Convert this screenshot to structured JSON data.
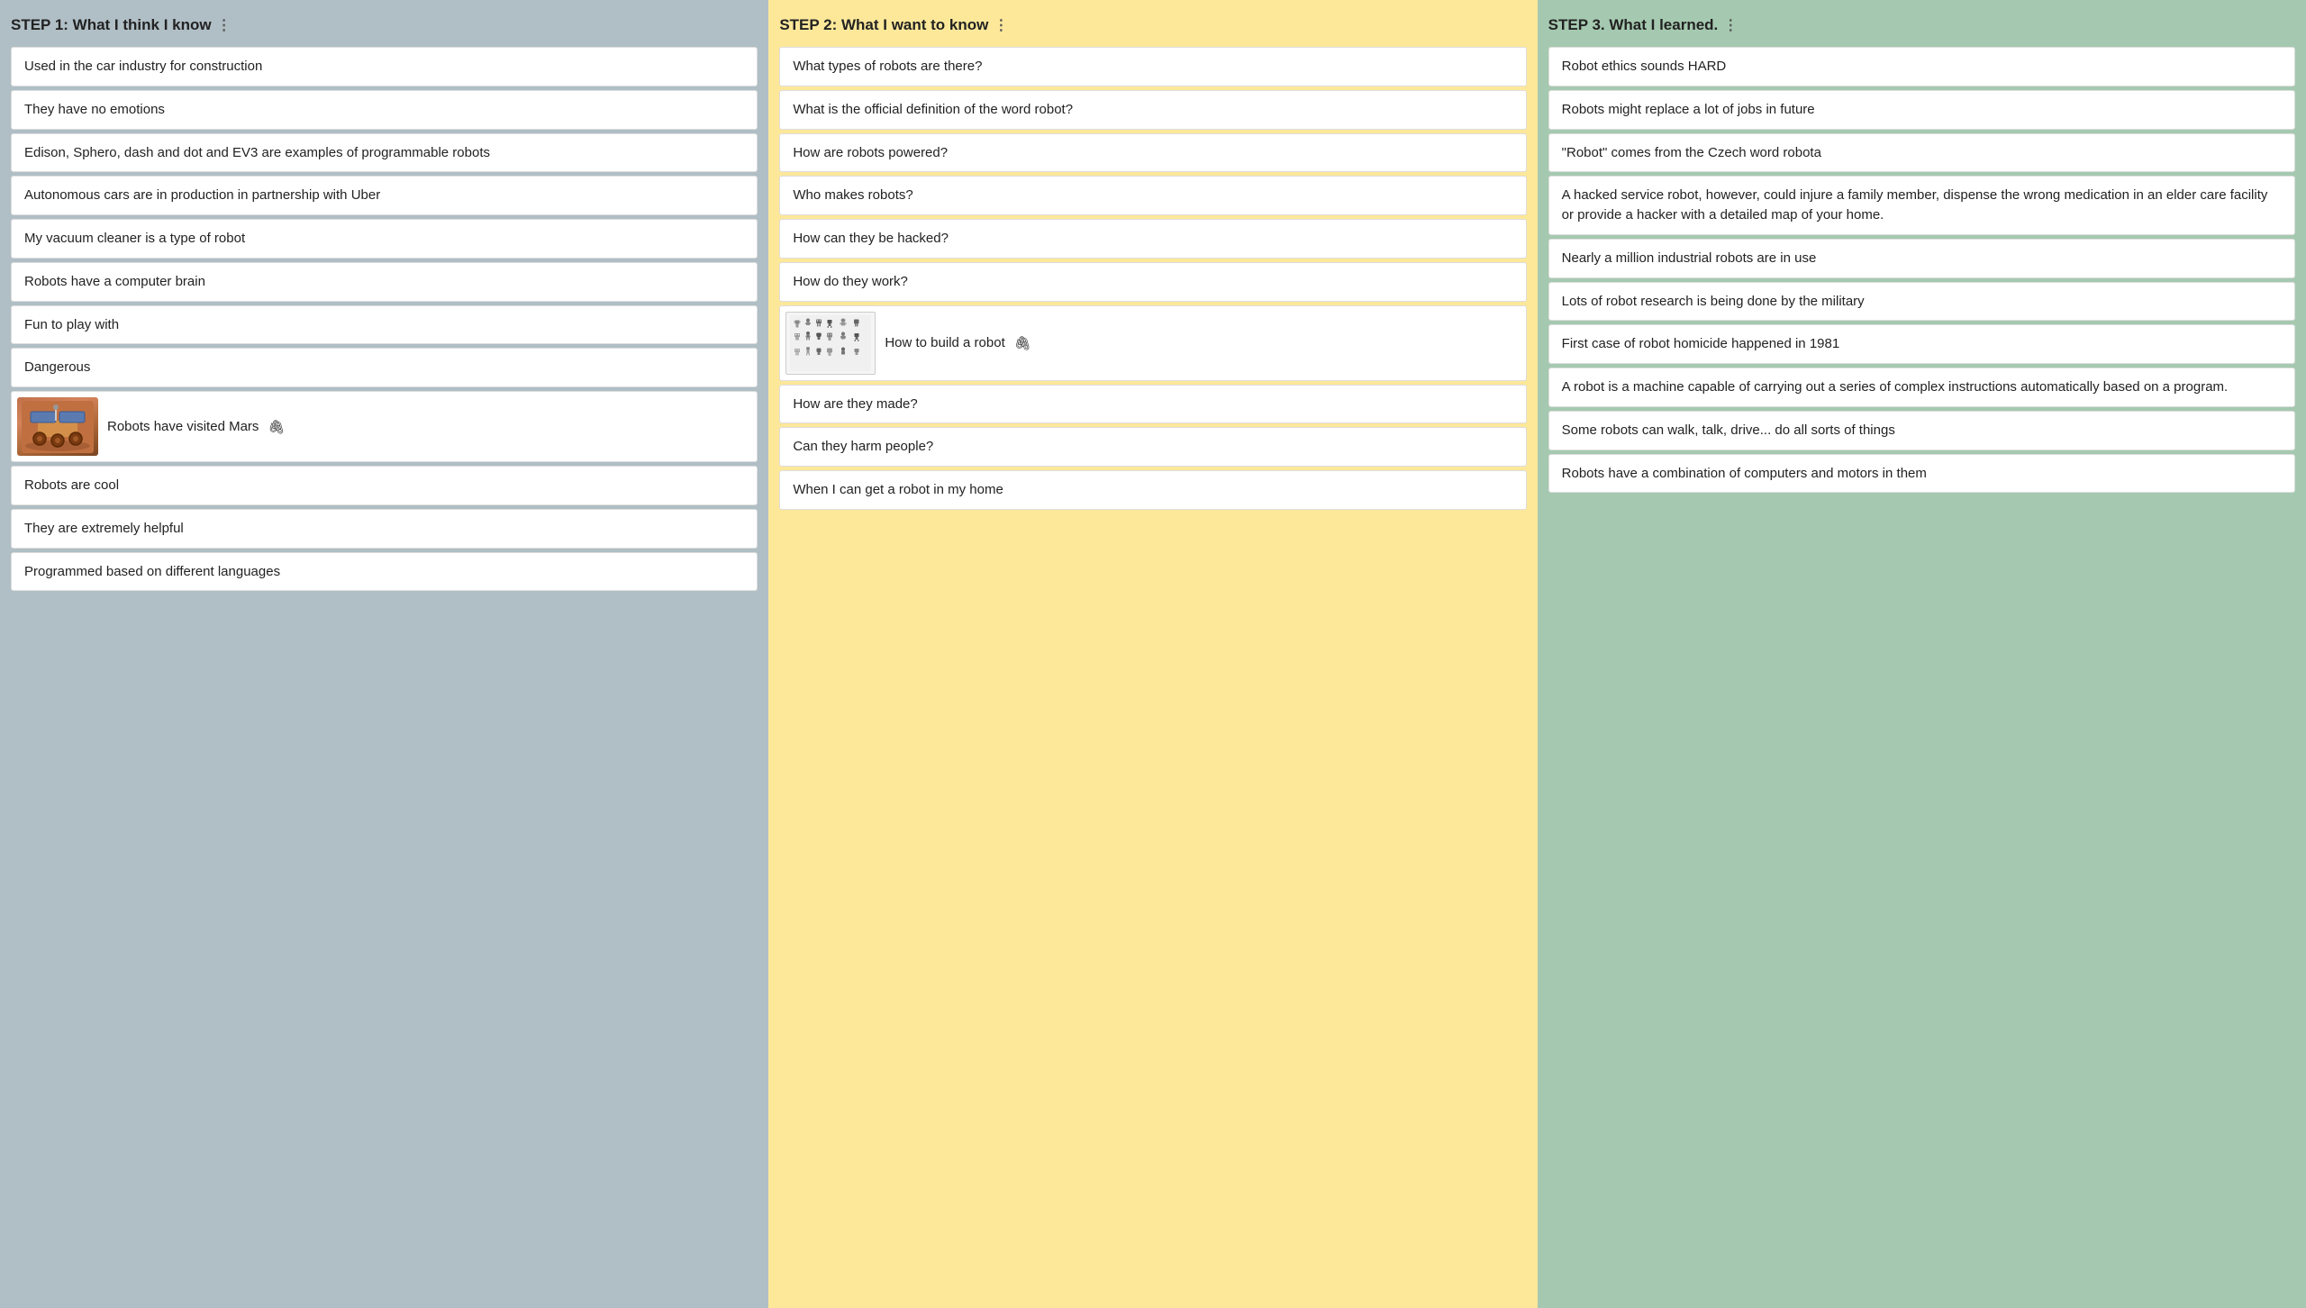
{
  "columns": [
    {
      "id": "know",
      "header": "STEP 1: What I think I know",
      "bg": "#b0bec5",
      "items": [
        {
          "type": "text",
          "text": "Used in the car industry for construction"
        },
        {
          "type": "text",
          "text": "They have no emotions"
        },
        {
          "type": "text",
          "text": "Edison, Sphero, dash and dot and EV3 are examples of programmable robots"
        },
        {
          "type": "text",
          "text": "Autonomous cars are in production in partnership with Uber"
        },
        {
          "type": "text",
          "text": "My vacuum cleaner is a type of robot"
        },
        {
          "type": "text",
          "text": "Robots have a computer brain"
        },
        {
          "type": "text",
          "text": "Fun to play with"
        },
        {
          "type": "text",
          "text": "Dangerous"
        },
        {
          "type": "image",
          "text": "Robots have visited Mars",
          "hasAttach": true
        },
        {
          "type": "text",
          "text": "Robots are cool"
        },
        {
          "type": "text",
          "text": "They are extremely helpful"
        },
        {
          "type": "text",
          "text": "Programmed based on different languages"
        }
      ]
    },
    {
      "id": "want",
      "header": "STEP 2: What I want to know",
      "bg": "#fde89a",
      "items": [
        {
          "type": "text",
          "text": "What types of robots are there?"
        },
        {
          "type": "text",
          "text": "What is the official definition of the word robot?"
        },
        {
          "type": "text",
          "text": "How are robots powered?"
        },
        {
          "type": "text",
          "text": "Who makes robots?"
        },
        {
          "type": "text",
          "text": "How can they be hacked?"
        },
        {
          "type": "text",
          "text": "How do they work?"
        },
        {
          "type": "robots-image",
          "text": "How to build a robot",
          "hasAttach": true
        },
        {
          "type": "text",
          "text": "How are they made?"
        },
        {
          "type": "text",
          "text": "Can they harm people?"
        },
        {
          "type": "text",
          "text": "When I can get a robot in my home"
        }
      ]
    },
    {
      "id": "learned",
      "header": "STEP 3. What I learned.",
      "bg": "#a5c9b0",
      "items": [
        {
          "type": "text",
          "text": "Robot ethics sounds HARD"
        },
        {
          "type": "text",
          "text": "Robots might replace a lot of jobs in future"
        },
        {
          "type": "text",
          "text": "\"Robot\" comes from the Czech word robota"
        },
        {
          "type": "text",
          "text": "A hacked service robot, however, could injure a family member, dispense the wrong medication in an elder care facility or provide a hacker with a detailed map of your home."
        },
        {
          "type": "text",
          "text": "Nearly a million industrial robots are in use"
        },
        {
          "type": "text",
          "text": "Lots of robot research is being done by the military"
        },
        {
          "type": "text",
          "text": "First case of robot homicide happened in 1981"
        },
        {
          "type": "text",
          "text": "A robot is a  machine capable of carrying out a series of complex instructions automatically based on a program."
        },
        {
          "type": "text",
          "text": "Some robots can walk, talk, drive... do all sorts of things"
        },
        {
          "type": "text",
          "text": "Robots have a combination of computers and motors in them"
        }
      ]
    }
  ],
  "icons": {
    "menu_dots": "⋮",
    "attach": "🖇",
    "mars_emoji": "🚀",
    "robots_emoji": "🤖"
  }
}
